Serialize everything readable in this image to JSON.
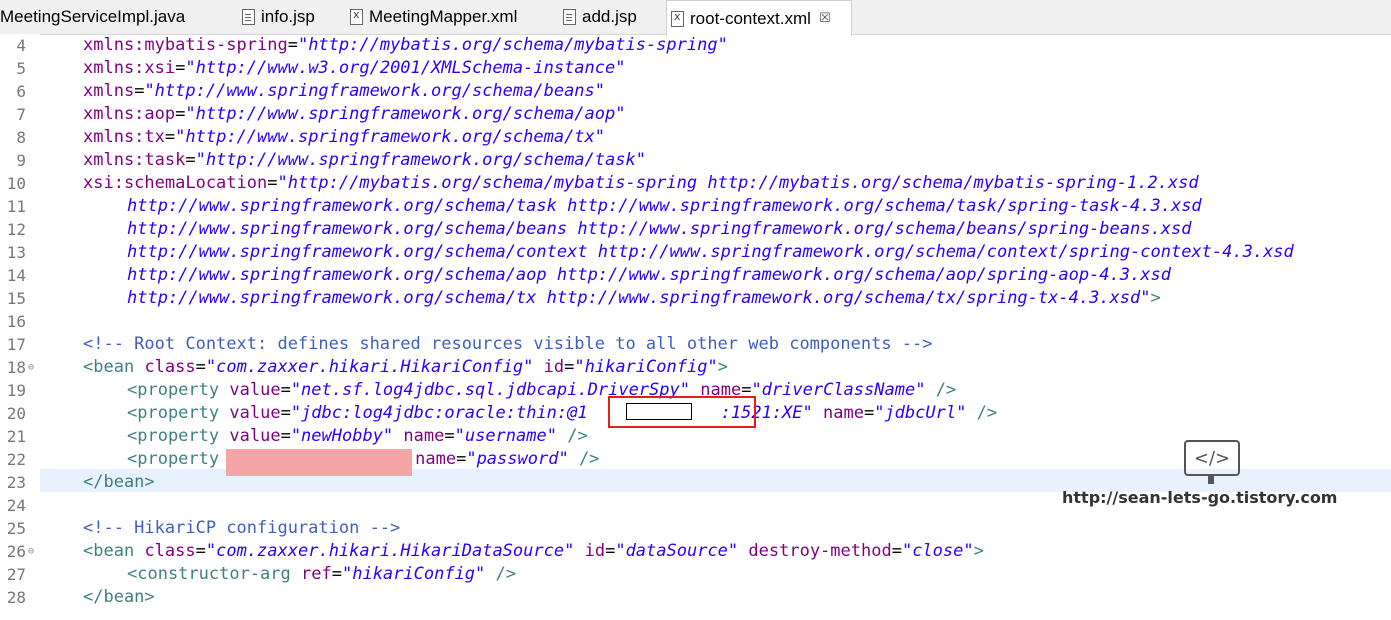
{
  "tabs": [
    {
      "label": "MeetingServiceImpl.java",
      "icon": "java-file-icon"
    },
    {
      "label": "info.jsp",
      "icon": "jsp-file-icon"
    },
    {
      "label": "MeetingMapper.xml",
      "icon": "xml-file-icon"
    },
    {
      "label": "add.jsp",
      "icon": "jsp-file-icon"
    },
    {
      "label": "root-context.xml",
      "icon": "xml-file-icon",
      "active": true,
      "close": "☒"
    }
  ],
  "line_numbers": [
    "4",
    "5",
    "6",
    "7",
    "8",
    "9",
    "10",
    "11",
    "12",
    "13",
    "14",
    "15",
    "16",
    "17",
    "18",
    "19",
    "20",
    "21",
    "22",
    "23",
    "24",
    "25",
    "26",
    "27",
    "28"
  ],
  "code": {
    "l4": {
      "a": "xmlns:mybatis-spring",
      "s": "\"http://mybatis.org/schema/mybatis-spring\""
    },
    "l5": {
      "a": "xmlns:xsi",
      "s": "\"http://www.w3.org/2001/XMLSchema-instance\""
    },
    "l6": {
      "a": "xmlns",
      "s": "\"http://www.springframework.org/schema/beans\""
    },
    "l7": {
      "a": "xmlns:aop",
      "s": "\"http://www.springframework.org/schema/aop\""
    },
    "l8": {
      "a": "xmlns:tx",
      "s": "\"http://www.springframework.org/schema/tx\""
    },
    "l9": {
      "a": "xmlns:task",
      "s": "\"http://www.springframework.org/schema/task\""
    },
    "l10": {
      "a": "xsi:schemaLocation",
      "s": "\"http://mybatis.org/schema/mybatis-spring http://mybatis.org/schema/mybatis-spring-1.2.xsd"
    },
    "l11": "http://www.springframework.org/schema/task http://www.springframework.org/schema/task/spring-task-4.3.xsd",
    "l12": "http://www.springframework.org/schema/beans http://www.springframework.org/schema/beans/spring-beans.xsd",
    "l13": "http://www.springframework.org/schema/context http://www.springframework.org/schema/context/spring-context-4.3.xsd",
    "l14": "http://www.springframework.org/schema/aop http://www.springframework.org/schema/aop/spring-aop-4.3.xsd",
    "l15": {
      "s": "http://www.springframework.org/schema/tx http://www.springframework.org/schema/tx/spring-tx-4.3.xsd\"",
      "t": ">"
    },
    "l17": "<!-- Root Context: defines shared resources visible to all other web components -->",
    "l18": {
      "t1": "<bean",
      "a1": "class",
      "s1": "\"com.zaxxer.hikari.HikariConfig\"",
      "a2": "id",
      "s2": "\"hikariConfig\"",
      "t2": ">"
    },
    "l19": {
      "t1": "<property",
      "a1": "value",
      "s1": "\"net.sf.log4jdbc.sql.jdbcapi.DriverSpy\"",
      "a2": "name",
      "s2": "\"driverClassName\"",
      "t2": "/>"
    },
    "l20": {
      "t1": "<property",
      "a1": "value",
      "s1a": "\"jdbc:log4jdbc:oracle:thin:@1",
      "s1b": ":1521:XE\"",
      "a2": "name",
      "s2": "\"jdbcUrl\"",
      "t2": "/>"
    },
    "l21": {
      "t1": "<property",
      "a1": "value",
      "s1": "\"newHobby\"",
      "a2": "name",
      "s2": "\"username\"",
      "t2": "/>"
    },
    "l22": {
      "t1": "<property",
      "a2": "name",
      "s2": "\"password\"",
      "t2": "/>"
    },
    "l23": "</bean>",
    "l25": "<!-- HikariCP configuration -->",
    "l26": {
      "t1": "<bean",
      "a1": "class",
      "s1": "\"com.zaxxer.hikari.HikariDataSource\"",
      "a2": "id",
      "s2": "\"dataSource\"",
      "a3": "destroy-method",
      "s3": "\"close\"",
      "t2": ">"
    },
    "l27": {
      "t1": "<constructor-arg",
      "a1": "ref",
      "s1": "\"hikariConfig\"",
      "t2": "/>"
    },
    "l28": "</bean>"
  },
  "watermark": {
    "icon": "code-monitor-icon",
    "glyph": "</>",
    "text": "http://sean-lets-go.tistory.com"
  },
  "colors": {
    "attribute": "#7f007f",
    "string": "#2a00ff",
    "tag": "#3f7f7f",
    "comment": "#3f5fbf",
    "highlight": "#e8f2fe",
    "annotation_box": "#e0201c",
    "redaction": "#f4a4a4"
  }
}
